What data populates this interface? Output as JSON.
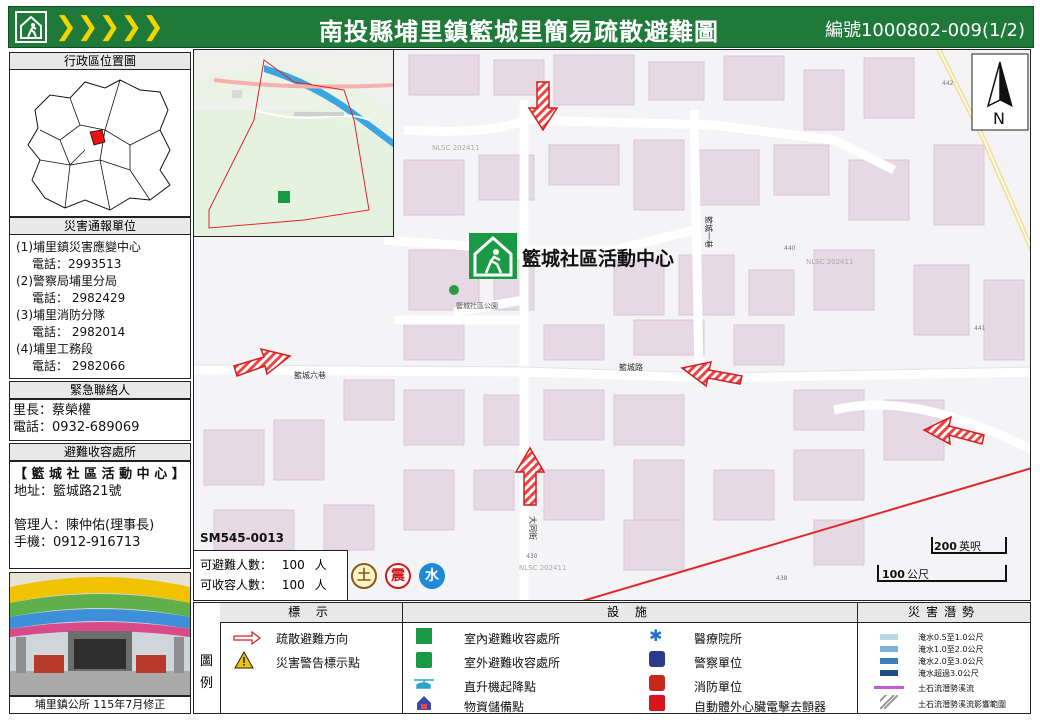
{
  "header": {
    "title": "南投縣埔里鎮籃城里簡易疏散避難圖",
    "code": "編號1000802-009(1/2)",
    "chevrons": "❯❯❯❯❯"
  },
  "left": {
    "location_map_title": "行政區位置圖",
    "report_units_title": "災害通報單位",
    "report_units": [
      {
        "name": "(1)埔里鎮災害應變中心",
        "phone": "電話：2993513"
      },
      {
        "name": "(2)警察局埔里分局",
        "phone": "電話： 2982429"
      },
      {
        "name": "(3)埔里消防分隊",
        "phone": "電話： 2982014"
      },
      {
        "name": "(4)埔里工務段",
        "phone": "電話： 2982066"
      }
    ],
    "contact_title": "緊急聯絡人",
    "contact": [
      "里長：蔡榮權",
      "電話：0932-689069"
    ],
    "shelter_title": "避難收容處所",
    "shelter": {
      "name": "【 籃 城 社 區 活 動 中 心 】",
      "address": "地址：籃城路21號",
      "manager": "管理人：陳仲佑(理事長)",
      "mobile": "手機：0912-916713"
    },
    "footer": "埔里鎮公所 115年7月修正"
  },
  "map": {
    "shelter_label": "籃城社區活動中心",
    "park_label": "籃城社區公園",
    "road_labels": [
      "籃城六巷",
      "籃城路",
      "大同街",
      "籃城一巷"
    ],
    "nlsc": [
      "NLSC 202411",
      "NLSC 202411",
      "NLSC 202411"
    ],
    "map_id": "SM545-0013",
    "capacity": [
      {
        "label": "可避難人數：",
        "value": "100",
        "unit": "人"
      },
      {
        "label": "可收容人數：",
        "value": "100",
        "unit": "人"
      }
    ],
    "hazards": [
      {
        "char": "土",
        "color": "#8a5a1a"
      },
      {
        "char": "震",
        "color": "#d21a1a"
      },
      {
        "char": "水",
        "color": "#1f8ad8"
      }
    ],
    "scale": [
      {
        "value": "200",
        "unit": "英呎"
      },
      {
        "value": "100",
        "unit": "公尺"
      }
    ],
    "north": "N",
    "number_marks": [
      "442",
      "441",
      "440",
      "438",
      "430"
    ]
  },
  "legend": {
    "side_label": "圖例",
    "col1_title": "標 示",
    "col2_title": "設 施",
    "col3_title": "災害潛勢",
    "col1": [
      "疏散避難方向",
      "災害警告標示點"
    ],
    "col2a": [
      "室內避難收容處所",
      "室外避難收容處所",
      "直升機起降點",
      "物資儲備點"
    ],
    "col2b": [
      "醫療院所",
      "警察單位",
      "消防單位",
      "自動體外心臟電擊去顫器"
    ],
    "col3": [
      {
        "label": "淹水0.5至1.0公尺",
        "color": "#b8d8ec"
      },
      {
        "label": "淹水1.0至2.0公尺",
        "color": "#7fb2d6"
      },
      {
        "label": "淹水2.0至3.0公尺",
        "color": "#3f7fb8"
      },
      {
        "label": "淹水超過3.0公尺",
        "color": "#1d4f86"
      },
      {
        "label": "土石流潛勢溪流",
        "color": "#c45ad8"
      },
      {
        "label": "土石流潛勢溪流影響範圍",
        "color": "#999999"
      }
    ]
  }
}
